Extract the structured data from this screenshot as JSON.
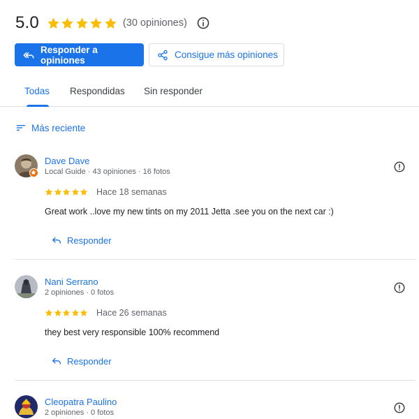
{
  "summary": {
    "score": "5.0",
    "stars": 5,
    "count_label": "(30 opiniones)"
  },
  "actions": {
    "reply_label": "Responder a opiniones",
    "get_more_label": "Consigue más opiniones"
  },
  "tabs": [
    {
      "label": "Todas",
      "active": true
    },
    {
      "label": "Respondidas",
      "active": false
    },
    {
      "label": "Sin responder",
      "active": false
    }
  ],
  "sort": {
    "label": "Más reciente"
  },
  "reviews": [
    {
      "name": "Dave Dave",
      "meta": "Local Guide · 43 opiniones · 16 fotos",
      "stars": 5,
      "time": "Hace 18 semanas",
      "text": "Great work ..love my new tints on my 2011 Jetta .see you on the next car :)",
      "reply_label": "Responder"
    },
    {
      "name": "Nani Serrano",
      "meta": "2 opiniones · 0 fotos",
      "stars": 5,
      "time": "Hace 26 semanas",
      "text": "they best very responsible 100% recommend",
      "reply_label": "Responder"
    },
    {
      "name": "Cleopatra Paulino",
      "meta": "2 opiniones · 0 fotos"
    }
  ],
  "colors": {
    "accent": "#1a73e8",
    "star": "#fbbc04",
    "local_guide_badge": "#e8710a"
  },
  "icons": {
    "info": "info-icon",
    "reply": "reply-arrow-icon",
    "share": "share-icon",
    "sort": "sort-lines-icon",
    "flag": "report-icon",
    "star": "star-icon"
  }
}
